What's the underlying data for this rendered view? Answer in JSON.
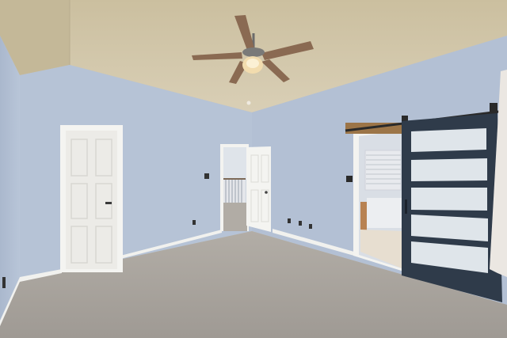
{
  "scene": {
    "description_colors": {
      "ceiling": "#cfc6ae",
      "wall_blue": "#b9c6d9",
      "wall_blue_shadow": "#a9b6ca",
      "carpet": "#a9a49e",
      "trim": "#f4f4f1",
      "barn_door": "#2f3b4a",
      "barn_door_glass": "#dfe5ea",
      "fan_blade": "#8a6a52"
    }
  }
}
